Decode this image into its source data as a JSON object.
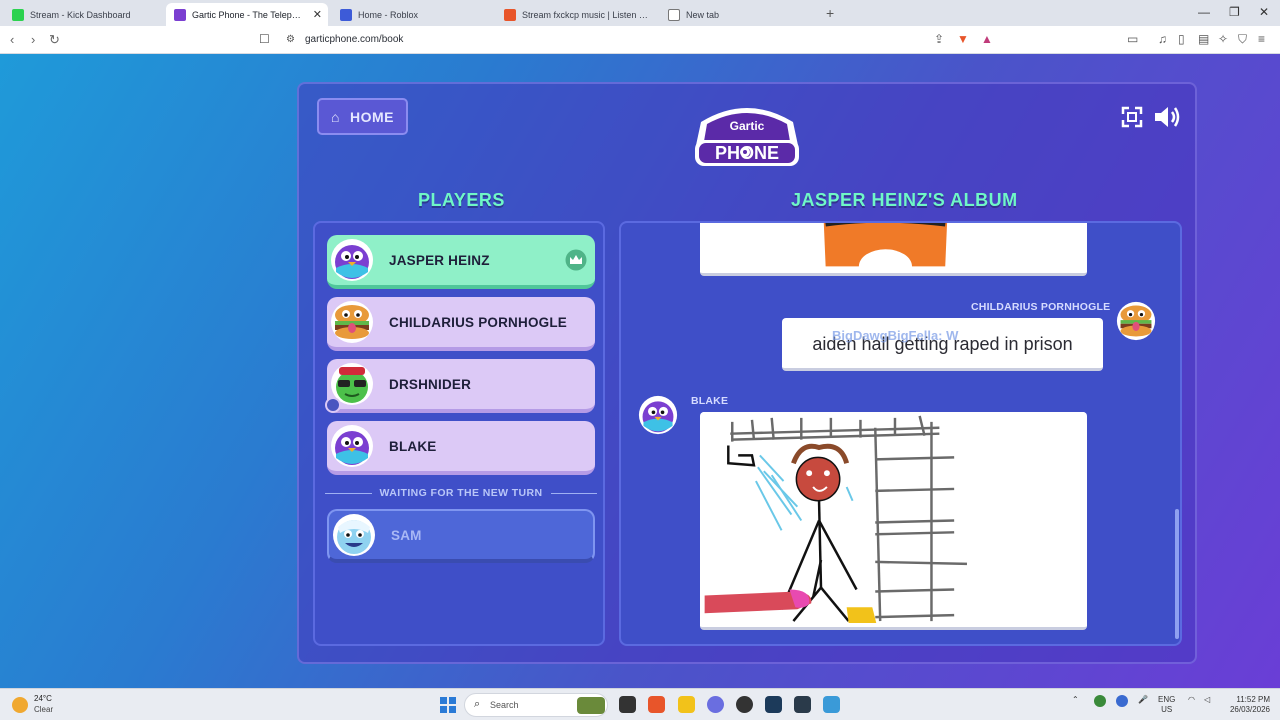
{
  "browser": {
    "tabs": [
      {
        "title": "Stream - Kick Dashboard",
        "icon": "kick-icon",
        "active": false
      },
      {
        "title": "Gartic Phone - The Telephone Game",
        "icon": "gartic-icon",
        "active": true
      },
      {
        "title": "Home - Roblox",
        "icon": "roblox-icon",
        "active": false
      },
      {
        "title": "Stream fxckcp music | Listen to songs",
        "icon": "soundcloud-icon",
        "active": false
      },
      {
        "title": "New tab",
        "icon": "brave-icon",
        "active": false
      }
    ],
    "url": "garticphone.com/book"
  },
  "header": {
    "home_label": "HOME",
    "logo_top": "Gartic",
    "logo_bottom": "PHONE"
  },
  "players": {
    "title": "PLAYERS",
    "list": [
      {
        "name": "JASPER HEINZ",
        "avatar": "purple-bird-icon",
        "role": "host"
      },
      {
        "name": "CHILDARIUS PORNHOGLE",
        "avatar": "burger-avatar-icon",
        "role": "player"
      },
      {
        "name": "DRSHNIDER",
        "avatar": "green-avatar-icon",
        "role": "player"
      },
      {
        "name": "BLAKE",
        "avatar": "purple-bird-icon",
        "role": "player"
      }
    ],
    "waiting_label": "WAITING FOR THE NEW TURN",
    "waiting": [
      {
        "name": "SAM",
        "avatar": "yeti-avatar-icon"
      }
    ]
  },
  "album": {
    "title": "JASPER HEINZ'S ALBUM",
    "entries": [
      {
        "type": "drawing",
        "author": ""
      },
      {
        "type": "text",
        "author": "CHILDARIUS PORNHOGLE",
        "text": "aiden hall getting raped in prison",
        "overlay": "BigDawgBigFella: W"
      },
      {
        "type": "drawing",
        "author": "BLAKE"
      }
    ]
  },
  "taskbar": {
    "temperature": "24°C",
    "condition": "Clear",
    "search_placeholder": "Search",
    "lang_top": "ENG",
    "lang_bottom": "US",
    "time": "11:52 PM",
    "date": "26/03/2026"
  },
  "colors": {
    "accent_green": "#6ff7c7",
    "panel": "#3f4fc8",
    "host_row": "#8ff0c8",
    "player_row": "#dcc9f6"
  }
}
